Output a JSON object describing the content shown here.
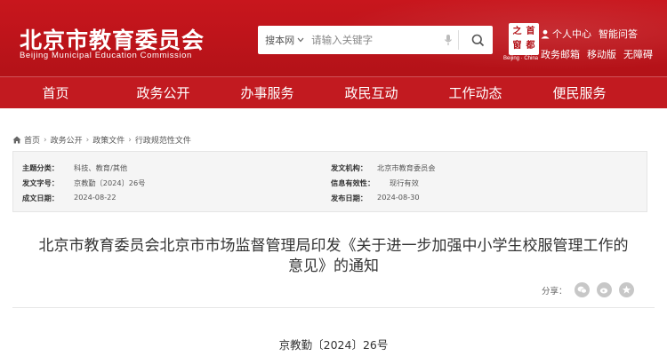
{
  "header": {
    "title": "北京市教育委员会",
    "subtitle": "Beijing Municipal Education Commission",
    "search": {
      "scope": "搜本网",
      "placeholder": "请输入关键字"
    },
    "seal": {
      "chars": [
        "之",
        "首",
        "窗",
        "都"
      ],
      "caption": "Beijing · China"
    },
    "links": [
      {
        "label": "个人中心",
        "icon": "user-icon"
      },
      {
        "label": "智能问答"
      },
      {
        "label": "政务邮箱"
      },
      {
        "label": "移动版"
      },
      {
        "label": "无障碍"
      }
    ]
  },
  "nav": [
    "首页",
    "政务公开",
    "办事服务",
    "政民互动",
    "工作动态",
    "便民服务"
  ],
  "breadcrumb": [
    "首页",
    "政务公开",
    "政策文件",
    "行政规范性文件"
  ],
  "info": {
    "topic_label": "主题分类：",
    "topic": "科技、教育/其他",
    "org_label": "发文机构：",
    "org": "北京市教育委员会",
    "docno_label": "发文字号：",
    "docno": "京教勤〔2024〕26号",
    "validity_label": "信息有效性：",
    "validity": "现行有效",
    "created_label": "成文日期：",
    "created": "2024-08-22",
    "published_label": "发布日期：",
    "published": "2024-08-30"
  },
  "document": {
    "title_line1": "北京市教育委员会北京市市场监督管理局印发《关于进一步加强中小学生校服管理工作的",
    "title_line2": "意见》的通知",
    "share_label": "分享：",
    "number": "京教勤〔2024〕26号"
  },
  "colors": {
    "brand_red": "#c8161d",
    "nav_red": "#c21a20"
  }
}
